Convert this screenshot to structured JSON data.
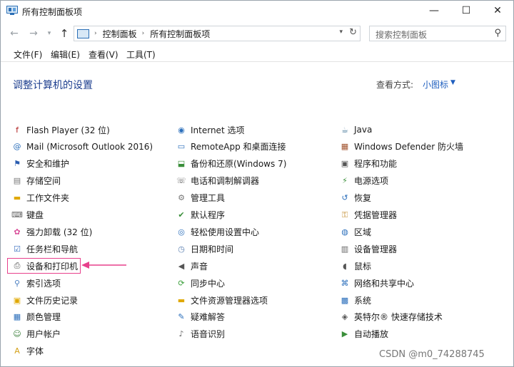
{
  "window": {
    "title": "所有控制面板项",
    "minimize_glyph": "—",
    "maximize_glyph": "☐",
    "close_glyph": "✕"
  },
  "address_bar": {
    "path": [
      "控制面板",
      "所有控制面板项"
    ],
    "search_placeholder": "搜索控制面板"
  },
  "menu": [
    "文件(F)",
    "编辑(E)",
    "查看(V)",
    "工具(T)"
  ],
  "content": {
    "title": "调整计算机的设置",
    "view_by_label": "查看方式:",
    "view_by_value": "小图标"
  },
  "columns": [
    [
      {
        "label": "Flash Player (32 位)",
        "icon": "flash-icon",
        "color": "#b02020"
      },
      {
        "label": "Mail (Microsoft Outlook 2016)",
        "icon": "mail-icon",
        "color": "#2a6ebb"
      },
      {
        "label": "安全和维护",
        "icon": "flag-icon",
        "color": "#2a5db0"
      },
      {
        "label": "存储空间",
        "icon": "storage-icon",
        "color": "#777777"
      },
      {
        "label": "工作文件夹",
        "icon": "folder-icon",
        "color": "#e0a800"
      },
      {
        "label": "键盘",
        "icon": "keyboard-icon",
        "color": "#666666"
      },
      {
        "label": "强力卸载 (32 位)",
        "icon": "uninstall-icon",
        "color": "#d94f9a"
      },
      {
        "label": "任务栏和导航",
        "icon": "taskbar-icon",
        "color": "#3a6fbf"
      },
      {
        "label": "设备和打印机",
        "icon": "printer-icon",
        "color": "#555555"
      },
      {
        "label": "索引选项",
        "icon": "index-icon",
        "color": "#4a7fc1"
      },
      {
        "label": "文件历史记录",
        "icon": "file-history-icon",
        "color": "#e0a800"
      },
      {
        "label": "颜色管理",
        "icon": "color-management-icon",
        "color": "#2a6ebb"
      },
      {
        "label": "用户帐户",
        "icon": "users-icon",
        "color": "#3a7f3a"
      },
      {
        "label": "字体",
        "icon": "font-icon",
        "color": "#d4a017"
      }
    ],
    [
      {
        "label": "Internet 选项",
        "icon": "internet-icon",
        "color": "#2a6ebb"
      },
      {
        "label": "RemoteApp 和桌面连接",
        "icon": "remoteapp-icon",
        "color": "#2a6ebb"
      },
      {
        "label": "备份和还原(Windows 7)",
        "icon": "backup-icon",
        "color": "#3a8f3a"
      },
      {
        "label": "电话和调制解调器",
        "icon": "phone-icon",
        "color": "#666666"
      },
      {
        "label": "管理工具",
        "icon": "admin-tools-icon",
        "color": "#777777"
      },
      {
        "label": "默认程序",
        "icon": "default-programs-icon",
        "color": "#3a8f3a"
      },
      {
        "label": "轻松使用设置中心",
        "icon": "ease-of-access-icon",
        "color": "#2a6ebb"
      },
      {
        "label": "日期和时间",
        "icon": "clock-icon",
        "color": "#5a7fb0"
      },
      {
        "label": "声音",
        "icon": "speaker-icon",
        "color": "#555555"
      },
      {
        "label": "同步中心",
        "icon": "sync-icon",
        "color": "#3a9f3a"
      },
      {
        "label": "文件资源管理器选项",
        "icon": "explorer-options-icon",
        "color": "#e0a800"
      },
      {
        "label": "疑难解答",
        "icon": "troubleshoot-icon",
        "color": "#2a6ebb"
      },
      {
        "label": "语音识别",
        "icon": "microphone-icon",
        "color": "#666666"
      }
    ],
    [
      {
        "label": "Java",
        "icon": "java-icon",
        "color": "#5382a1"
      },
      {
        "label": "Windows Defender 防火墙",
        "icon": "firewall-icon",
        "color": "#a0522d"
      },
      {
        "label": "程序和功能",
        "icon": "programs-icon",
        "color": "#555555"
      },
      {
        "label": "电源选项",
        "icon": "power-icon",
        "color": "#3a8f3a"
      },
      {
        "label": "恢复",
        "icon": "recovery-icon",
        "color": "#2a6ebb"
      },
      {
        "label": "凭据管理器",
        "icon": "credential-icon",
        "color": "#c08a2a"
      },
      {
        "label": "区域",
        "icon": "region-icon",
        "color": "#2a6ebb"
      },
      {
        "label": "设备管理器",
        "icon": "device-manager-icon",
        "color": "#666666"
      },
      {
        "label": "鼠标",
        "icon": "mouse-icon",
        "color": "#555555"
      },
      {
        "label": "网络和共享中心",
        "icon": "network-icon",
        "color": "#2a6ebb"
      },
      {
        "label": "系统",
        "icon": "system-icon",
        "color": "#2a6ebb"
      },
      {
        "label": "英特尔® 快速存储技术",
        "icon": "intel-rst-icon",
        "color": "#555555"
      },
      {
        "label": "自动播放",
        "icon": "autoplay-icon",
        "color": "#3a8f3a"
      }
    ]
  ],
  "watermark": "CSDN @m0_74288745"
}
